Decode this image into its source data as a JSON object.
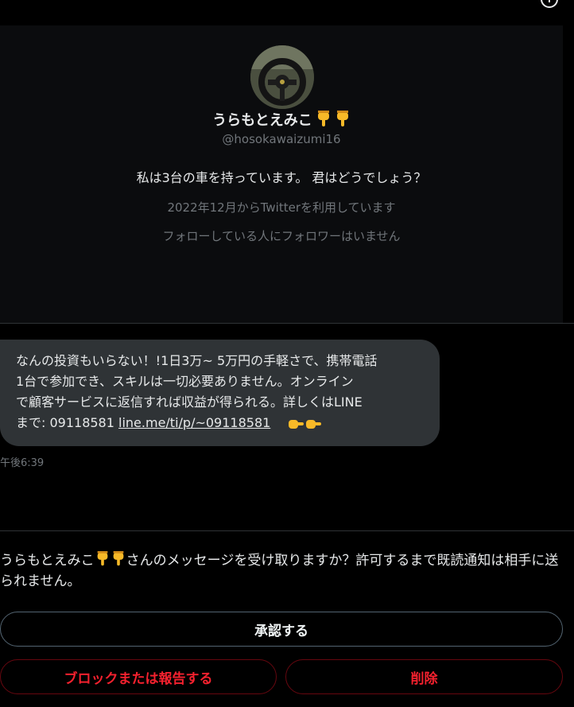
{
  "profile": {
    "display_name": "うらもとえみこ",
    "name_emoji_icons": [
      "point-down-icon",
      "point-down-icon"
    ],
    "handle": "@hosokawaizumi16",
    "bio": "私は3台の車を持っています。 君はどうでしょう？",
    "joined": "2022年12月からTwitterを利用しています",
    "followers_note": "フォローしている人にフォロワーはいません"
  },
  "message": {
    "lines": [
      "なんの投資もいらない！!1日3万~ 5万円の手軽さで、携帯電話",
      "1台で参加でき、スキルは一切必要ありません。オンライン",
      "で顧客サービスに返信すれば収益が得られる。詳しくはLINE"
    ],
    "last_line_prefix": "まで: 09118581  ",
    "link_text": "line.me/ti/p/~09118581",
    "trailing_emoji_icons": [
      "point-right-icon",
      "point-right-icon"
    ],
    "timestamp": "午後6:39"
  },
  "request": {
    "name": "うらもとえみこ",
    "text": "さんのメッセージを受け取りますか？許可するまで既読通知は相手に送られません。"
  },
  "buttons": {
    "accept": "承認する",
    "block_report": "ブロックまたは報告する",
    "delete": "削除"
  },
  "colors": {
    "background": "#000000",
    "bubble": "#2f3336",
    "muted_text": "#71767b",
    "danger": "#f4212e",
    "emoji_yellow": "#f7b928"
  }
}
